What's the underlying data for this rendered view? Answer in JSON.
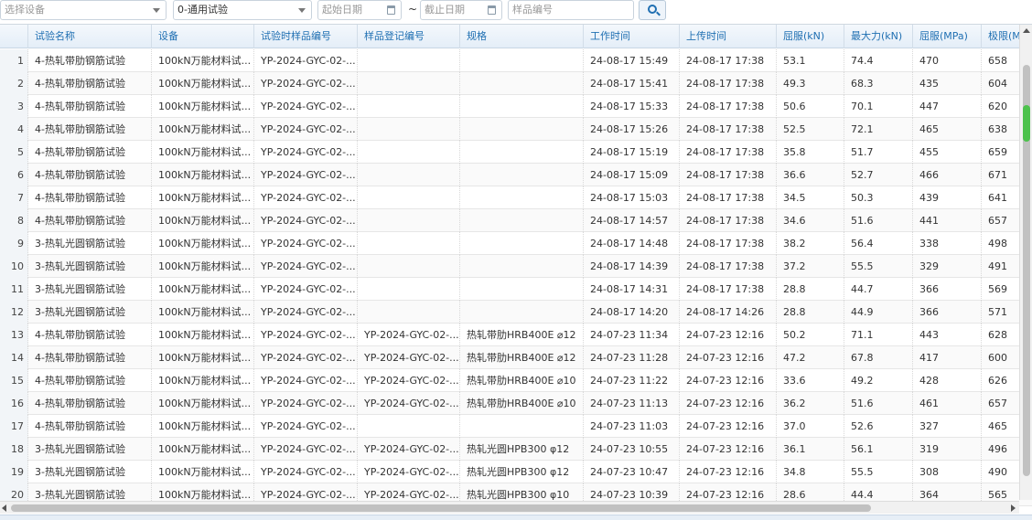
{
  "filters": {
    "device_placeholder": "选择设备",
    "test_type_value": "0-通用试验",
    "start_date_placeholder": "起始日期",
    "separator": "~",
    "end_date_placeholder": "截止日期",
    "sample_no_placeholder": "样品编号"
  },
  "table": {
    "columns": [
      "试验名称",
      "设备",
      "试验时样品编号",
      "样品登记编号",
      "规格",
      "工作时间",
      "上传时间",
      "屈服(kN)",
      "最大力(kN)",
      "屈服(MPa)",
      "极限(MPa)"
    ],
    "rows": [
      {
        "n": "1",
        "name": "4-热轧带肋钢筋试验",
        "device": "100kN万能材料试...",
        "sample": "YP-2024-GYC-02-...",
        "reg": "",
        "spec": "",
        "work": "24-08-17 15:49",
        "upload": "24-08-17 17:38",
        "yield_kn": "53.1",
        "max_kn": "74.4",
        "yield_mpa": "470",
        "ult_mpa": "658"
      },
      {
        "n": "2",
        "name": "4-热轧带肋钢筋试验",
        "device": "100kN万能材料试...",
        "sample": "YP-2024-GYC-02-...",
        "reg": "",
        "spec": "",
        "work": "24-08-17 15:41",
        "upload": "24-08-17 17:38",
        "yield_kn": "49.3",
        "max_kn": "68.3",
        "yield_mpa": "435",
        "ult_mpa": "604"
      },
      {
        "n": "3",
        "name": "4-热轧带肋钢筋试验",
        "device": "100kN万能材料试...",
        "sample": "YP-2024-GYC-02-...",
        "reg": "",
        "spec": "",
        "work": "24-08-17 15:33",
        "upload": "24-08-17 17:38",
        "yield_kn": "50.6",
        "max_kn": "70.1",
        "yield_mpa": "447",
        "ult_mpa": "620"
      },
      {
        "n": "4",
        "name": "4-热轧带肋钢筋试验",
        "device": "100kN万能材料试...",
        "sample": "YP-2024-GYC-02-...",
        "reg": "",
        "spec": "",
        "work": "24-08-17 15:26",
        "upload": "24-08-17 17:38",
        "yield_kn": "52.5",
        "max_kn": "72.1",
        "yield_mpa": "465",
        "ult_mpa": "638"
      },
      {
        "n": "5",
        "name": "4-热轧带肋钢筋试验",
        "device": "100kN万能材料试...",
        "sample": "YP-2024-GYC-02-...",
        "reg": "",
        "spec": "",
        "work": "24-08-17 15:19",
        "upload": "24-08-17 17:38",
        "yield_kn": "35.8",
        "max_kn": "51.7",
        "yield_mpa": "455",
        "ult_mpa": "659"
      },
      {
        "n": "6",
        "name": "4-热轧带肋钢筋试验",
        "device": "100kN万能材料试...",
        "sample": "YP-2024-GYC-02-...",
        "reg": "",
        "spec": "",
        "work": "24-08-17 15:09",
        "upload": "24-08-17 17:38",
        "yield_kn": "36.6",
        "max_kn": "52.7",
        "yield_mpa": "466",
        "ult_mpa": "671"
      },
      {
        "n": "7",
        "name": "4-热轧带肋钢筋试验",
        "device": "100kN万能材料试...",
        "sample": "YP-2024-GYC-02-...",
        "reg": "",
        "spec": "",
        "work": "24-08-17 15:03",
        "upload": "24-08-17 17:38",
        "yield_kn": "34.5",
        "max_kn": "50.3",
        "yield_mpa": "439",
        "ult_mpa": "641"
      },
      {
        "n": "8",
        "name": "4-热轧带肋钢筋试验",
        "device": "100kN万能材料试...",
        "sample": "YP-2024-GYC-02-...",
        "reg": "",
        "spec": "",
        "work": "24-08-17 14:57",
        "upload": "24-08-17 17:38",
        "yield_kn": "34.6",
        "max_kn": "51.6",
        "yield_mpa": "441",
        "ult_mpa": "657"
      },
      {
        "n": "9",
        "name": "3-热轧光圆钢筋试验",
        "device": "100kN万能材料试...",
        "sample": "YP-2024-GYC-02-...",
        "reg": "",
        "spec": "",
        "work": "24-08-17 14:48",
        "upload": "24-08-17 17:38",
        "yield_kn": "38.2",
        "max_kn": "56.4",
        "yield_mpa": "338",
        "ult_mpa": "498"
      },
      {
        "n": "10",
        "name": "3-热轧光圆钢筋试验",
        "device": "100kN万能材料试...",
        "sample": "YP-2024-GYC-02-...",
        "reg": "",
        "spec": "",
        "work": "24-08-17 14:39",
        "upload": "24-08-17 17:38",
        "yield_kn": "37.2",
        "max_kn": "55.5",
        "yield_mpa": "329",
        "ult_mpa": "491"
      },
      {
        "n": "11",
        "name": "3-热轧光圆钢筋试验",
        "device": "100kN万能材料试...",
        "sample": "YP-2024-GYC-02-...",
        "reg": "",
        "spec": "",
        "work": "24-08-17 14:31",
        "upload": "24-08-17 17:38",
        "yield_kn": "28.8",
        "max_kn": "44.7",
        "yield_mpa": "366",
        "ult_mpa": "569"
      },
      {
        "n": "12",
        "name": "3-热轧光圆钢筋试验",
        "device": "100kN万能材料试...",
        "sample": "YP-2024-GYC-02-...",
        "reg": "",
        "spec": "",
        "work": "24-08-17 14:20",
        "upload": "24-08-17 14:26",
        "yield_kn": "28.8",
        "max_kn": "44.9",
        "yield_mpa": "366",
        "ult_mpa": "571"
      },
      {
        "n": "13",
        "name": "4-热轧带肋钢筋试验",
        "device": "100kN万能材料试...",
        "sample": "YP-2024-GYC-02-...",
        "reg": "YP-2024-GYC-02-...",
        "spec": "热轧带肋HRB400E ⌀12",
        "work": "24-07-23 11:34",
        "upload": "24-07-23 12:16",
        "yield_kn": "50.2",
        "max_kn": "71.1",
        "yield_mpa": "443",
        "ult_mpa": "628"
      },
      {
        "n": "14",
        "name": "4-热轧带肋钢筋试验",
        "device": "100kN万能材料试...",
        "sample": "YP-2024-GYC-02-...",
        "reg": "YP-2024-GYC-02-...",
        "spec": "热轧带肋HRB400E ⌀12",
        "work": "24-07-23 11:28",
        "upload": "24-07-23 12:16",
        "yield_kn": "47.2",
        "max_kn": "67.8",
        "yield_mpa": "417",
        "ult_mpa": "600"
      },
      {
        "n": "15",
        "name": "4-热轧带肋钢筋试验",
        "device": "100kN万能材料试...",
        "sample": "YP-2024-GYC-02-...",
        "reg": "YP-2024-GYC-02-...",
        "spec": "热轧带肋HRB400E ⌀10",
        "work": "24-07-23 11:22",
        "upload": "24-07-23 12:16",
        "yield_kn": "33.6",
        "max_kn": "49.2",
        "yield_mpa": "428",
        "ult_mpa": "626"
      },
      {
        "n": "16",
        "name": "4-热轧带肋钢筋试验",
        "device": "100kN万能材料试...",
        "sample": "YP-2024-GYC-02-...",
        "reg": "YP-2024-GYC-02-...",
        "spec": "热轧带肋HRB400E ⌀10",
        "work": "24-07-23 11:13",
        "upload": "24-07-23 12:16",
        "yield_kn": "36.2",
        "max_kn": "51.6",
        "yield_mpa": "461",
        "ult_mpa": "657"
      },
      {
        "n": "17",
        "name": "4-热轧带肋钢筋试验",
        "device": "100kN万能材料试...",
        "sample": "YP-2024-GYC-02-...",
        "reg": "",
        "spec": "",
        "work": "24-07-23 11:03",
        "upload": "24-07-23 12:16",
        "yield_kn": "37.0",
        "max_kn": "52.6",
        "yield_mpa": "327",
        "ult_mpa": "465"
      },
      {
        "n": "18",
        "name": "3-热轧光圆钢筋试验",
        "device": "100kN万能材料试...",
        "sample": "YP-2024-GYC-02-...",
        "reg": "YP-2024-GYC-02-...",
        "spec": "热轧光圆HPB300 φ12",
        "work": "24-07-23 10:55",
        "upload": "24-07-23 12:16",
        "yield_kn": "36.1",
        "max_kn": "56.1",
        "yield_mpa": "319",
        "ult_mpa": "496"
      },
      {
        "n": "19",
        "name": "3-热轧光圆钢筋试验",
        "device": "100kN万能材料试...",
        "sample": "YP-2024-GYC-02-...",
        "reg": "YP-2024-GYC-02-...",
        "spec": "热轧光圆HPB300 φ12",
        "work": "24-07-23 10:47",
        "upload": "24-07-23 12:16",
        "yield_kn": "34.8",
        "max_kn": "55.5",
        "yield_mpa": "308",
        "ult_mpa": "490"
      },
      {
        "n": "20",
        "name": "3-热轧光圆钢筋试验",
        "device": "100kN万能材料试...",
        "sample": "YP-2024-GYC-02-...",
        "reg": "YP-2024-GYC-02-...",
        "spec": "热轧光圆HPB300 φ10",
        "work": "24-07-23 10:39",
        "upload": "24-07-23 12:16",
        "yield_kn": "28.6",
        "max_kn": "44.4",
        "yield_mpa": "364",
        "ult_mpa": "565"
      }
    ]
  }
}
